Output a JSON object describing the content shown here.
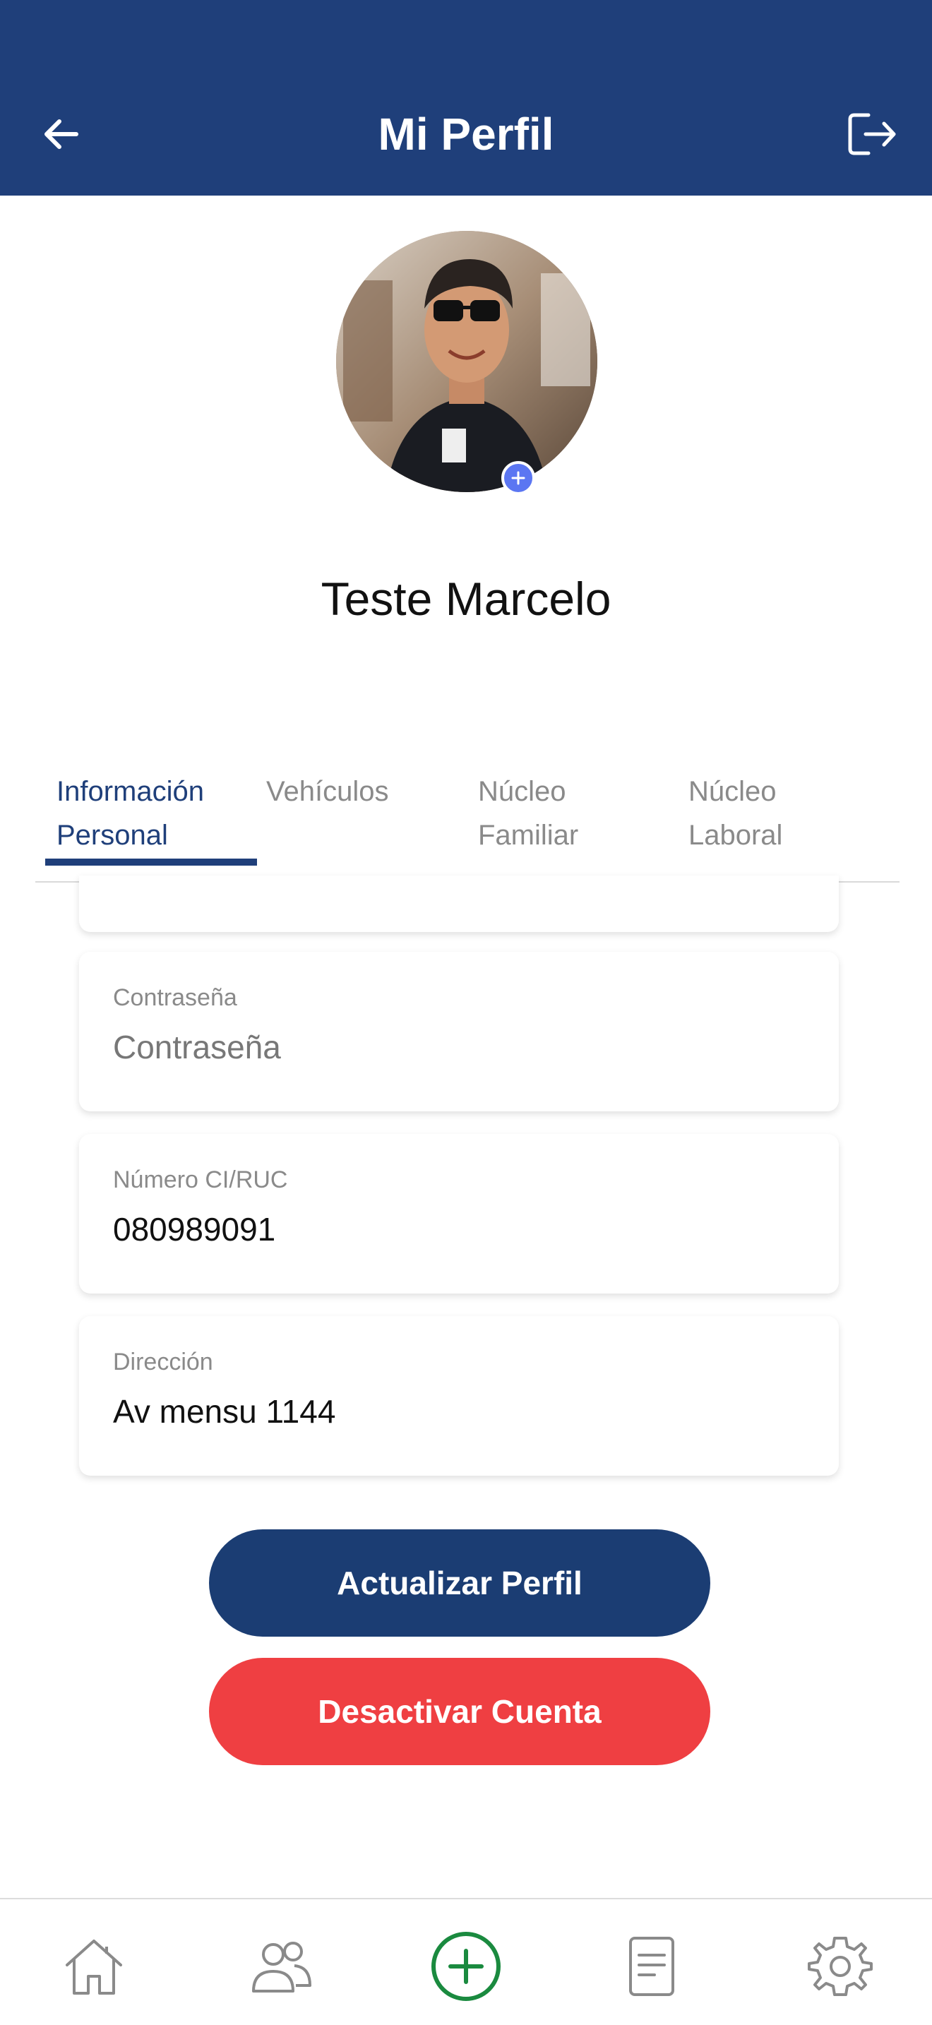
{
  "header": {
    "title": "Mi Perfil",
    "back_icon": "arrow-left-icon",
    "logout_icon": "logout-icon",
    "background_color": "#1f3f7a"
  },
  "profile": {
    "name": "Teste Marcelo",
    "avatar_badge_icon": "plus-icon",
    "avatar_badge_color": "#5b76f2"
  },
  "tabs": [
    {
      "label": "Información\nPersonal",
      "active": true
    },
    {
      "label": "Vehículos",
      "active": false
    },
    {
      "label": "Núcleo\nFamiliar",
      "active": false
    },
    {
      "label": "Núcleo\nLaboral",
      "active": false
    }
  ],
  "fields": {
    "password": {
      "label": "Contraseña",
      "value": "",
      "placeholder": "Contraseña"
    },
    "ci_ruc": {
      "label": "Número CI/RUC",
      "value": "080989091"
    },
    "address": {
      "label": "Dirección",
      "value": "Av mensu 1144"
    }
  },
  "buttons": {
    "update_label": "Actualizar Perfil",
    "update_color": "#1b3d73",
    "deactivate_label": "Desactivar Cuenta",
    "deactivate_color": "#ef3f42"
  },
  "bottom_nav": [
    {
      "icon": "home-icon"
    },
    {
      "icon": "users-icon"
    },
    {
      "icon": "add-circle-icon",
      "color": "#1a8a3f"
    },
    {
      "icon": "document-icon"
    },
    {
      "icon": "settings-icon"
    }
  ]
}
